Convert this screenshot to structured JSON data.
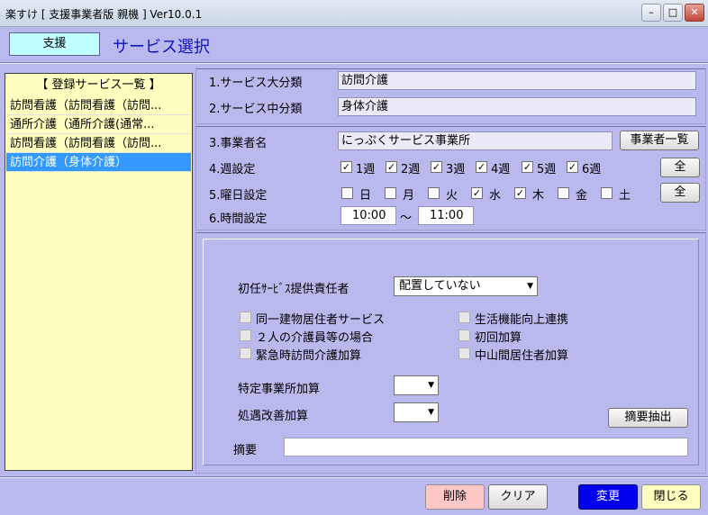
{
  "window": {
    "title": "楽すけ [ 支援事業者版 親機 ] Ver10.0.1"
  },
  "header": {
    "mode": "支援",
    "page_title": "サービス選択"
  },
  "list": {
    "header": "【 登録サービス一覧 】",
    "items": [
      {
        "label": "訪問看護（訪問看護（訪問...",
        "selected": false
      },
      {
        "label": "通所介護（通所介護(通常...",
        "selected": false
      },
      {
        "label": "訪問看護（訪問看護（訪問...",
        "selected": false
      },
      {
        "label": "訪問介護（身体介護）",
        "selected": true
      }
    ]
  },
  "service": {
    "major_label": "1.サービス大分類",
    "major_value": "訪問介護",
    "middle_label": "2.サービス中分類",
    "middle_value": "身体介護"
  },
  "provider": {
    "label": "3.事業者名",
    "value": "にっぷくサービス事業所",
    "list_button": "事業者一覧"
  },
  "weeks": {
    "label": "4.週設定",
    "all_button": "全",
    "items": [
      {
        "label": "1週",
        "checked": true
      },
      {
        "label": "2週",
        "checked": true
      },
      {
        "label": "3週",
        "checked": true
      },
      {
        "label": "4週",
        "checked": true
      },
      {
        "label": "5週",
        "checked": true
      },
      {
        "label": "6週",
        "checked": true
      }
    ]
  },
  "days": {
    "label": "5.曜日設定",
    "all_button": "全",
    "items": [
      {
        "label": "日",
        "checked": false
      },
      {
        "label": "月",
        "checked": false
      },
      {
        "label": "火",
        "checked": false
      },
      {
        "label": "水",
        "checked": true
      },
      {
        "label": "木",
        "checked": true
      },
      {
        "label": "金",
        "checked": false
      },
      {
        "label": "土",
        "checked": false
      }
    ]
  },
  "time": {
    "label": "6.時間設定",
    "start": "10:00",
    "separator": "～",
    "end": "11:00"
  },
  "options": {
    "first_responsible_label": "初任ｻｰﾋﾞｽ提供責任者",
    "first_responsible_value": "配置していない",
    "checks": [
      {
        "label": "同一建物居住者サービス",
        "checked": false
      },
      {
        "label": "２人の介護員等の場合",
        "checked": false
      },
      {
        "label": "緊急時訪問介護加算",
        "checked": false
      },
      {
        "label": "生活機能向上連携",
        "checked": false
      },
      {
        "label": "初回加算",
        "checked": false
      },
      {
        "label": "中山間居住者加算",
        "checked": false
      }
    ],
    "specific_label": "特定事業所加算",
    "improvement_label": "処遇改善加算",
    "extract_button": "摘要抽出",
    "memo_label": "摘要",
    "memo_value": ""
  },
  "footer": {
    "delete": "削除",
    "clear": "クリア",
    "change": "変更",
    "close": "閉じる"
  }
}
